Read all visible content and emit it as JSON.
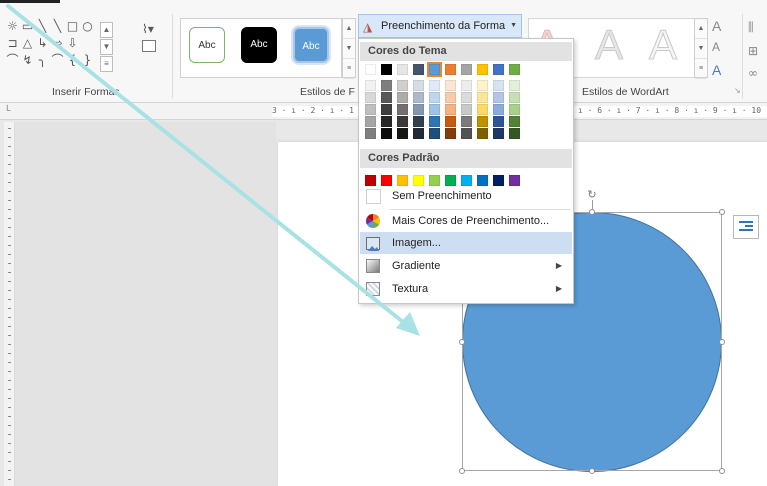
{
  "ribbon": {
    "insert_shapes_label": "Inserir Formas",
    "shape_styles_label": "Estilos de Forma",
    "shape_styles_truncated": "Estilos de F",
    "wordart_styles_label": "Estilos de WordArt",
    "style_swatches": [
      "Abc",
      "Abc",
      "Abc"
    ],
    "fill_button_label": "Preenchimento da Forma",
    "wordart_letters": [
      "A",
      "A",
      "A"
    ],
    "text_effect_letters": [
      "A",
      "A",
      "A"
    ],
    "shape_glyphs": [
      "☼",
      "▭",
      "╲",
      "╲",
      "□",
      "○",
      "⌇",
      "⊐",
      "△",
      "↳",
      "⇨",
      "⇩",
      "⌒",
      "↯",
      "╮",
      "⌒",
      "{",
      "}"
    ]
  },
  "ruler": {
    "left_marks": "3 · ı · 2 · ı · 1 ·",
    "right_marks": "ı · 6 · ı · 7 · ı · 8 · ı · 9 · ı · 10 · ı"
  },
  "menu": {
    "theme_colors_header": "Cores do Tema",
    "standard_colors_header": "Cores Padrão",
    "items": {
      "no_fill": "Sem Preenchimento",
      "more_colors": "Mais Cores de Preenchimento...",
      "picture": "Imagem...",
      "gradient": "Gradiente",
      "texture": "Textura"
    },
    "theme_base_colors": [
      "#ffffff",
      "#000000",
      "#e7e6e6",
      "#44546a",
      "#5b9bd5",
      "#ed7d31",
      "#a5a5a5",
      "#ffc000",
      "#4472c4",
      "#70ad47"
    ],
    "theme_shades": [
      [
        "#f2f2f2",
        "#7f7f7f",
        "#d0cece",
        "#d6dce4",
        "#deebf6",
        "#fbe5d5",
        "#ededed",
        "#fff2cc",
        "#d9e2f3",
        "#e2efd9"
      ],
      [
        "#d8d8d8",
        "#595959",
        "#aeabab",
        "#adb9ca",
        "#bdd7ee",
        "#f8cbad",
        "#dbdbdb",
        "#fee599",
        "#b4c6e7",
        "#c5e0b3"
      ],
      [
        "#bfbfbf",
        "#3f3f3f",
        "#757070",
        "#8496b0",
        "#9dc3e6",
        "#f4b183",
        "#c9c9c9",
        "#ffd965",
        "#8eaadb",
        "#a8d08d"
      ],
      [
        "#a5a5a5",
        "#262626",
        "#3a3838",
        "#323f4f",
        "#2e75b5",
        "#c55a11",
        "#7b7b7b",
        "#bf9000",
        "#2f5496",
        "#538135"
      ],
      [
        "#7f7f7f",
        "#0c0c0c",
        "#171616",
        "#222a35",
        "#1e4e79",
        "#833c0b",
        "#525252",
        "#7f6000",
        "#1f3864",
        "#375623"
      ]
    ],
    "standard_colors": [
      "#c00000",
      "#ff0000",
      "#ffc000",
      "#ffff00",
      "#92d050",
      "#00b050",
      "#00b0f0",
      "#0070c0",
      "#002060",
      "#7030a0"
    ],
    "selected_theme_color_index": 4
  },
  "shape": {
    "fill_color": "#5b9bd5",
    "outline_color": "#41719c",
    "type": "circle"
  },
  "annotation": {
    "arrow_color": "#a8e2e4"
  }
}
